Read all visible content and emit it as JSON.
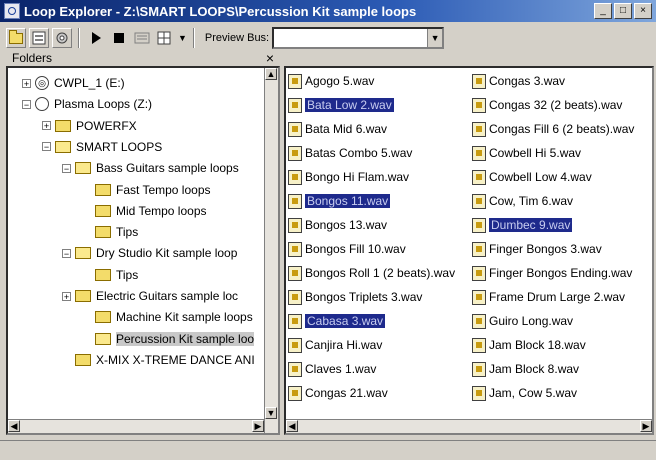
{
  "window": {
    "title": "Loop Explorer - Z:\\SMART LOOPS\\Percussion Kit sample loops",
    "colors": {
      "titlebar": "#0a246a",
      "selection": "#1e2a8c"
    }
  },
  "toolbar": {
    "preview_bus_label": "Preview Bus:",
    "preview_bus_value": ""
  },
  "folders_pane": {
    "header": "Folders",
    "close_glyph": "×",
    "tree": [
      {
        "label": "CWPL_1 (E:)",
        "kind": "cd",
        "expander": "+"
      },
      {
        "label": "Plasma Loops (Z:)",
        "kind": "drive",
        "expander": "−"
      },
      {
        "label": "POWERFX",
        "kind": "folder",
        "expander": "+"
      },
      {
        "label": "SMART LOOPS",
        "kind": "folder-open",
        "expander": "−"
      },
      {
        "label": "Bass Guitars sample loops",
        "kind": "folder-open",
        "expander": "−"
      },
      {
        "label": "Fast Tempo loops",
        "kind": "folder",
        "expander": ""
      },
      {
        "label": "Mid Tempo loops",
        "kind": "folder",
        "expander": ""
      },
      {
        "label": "Tips",
        "kind": "folder",
        "expander": ""
      },
      {
        "label": "Dry Studio Kit sample loop",
        "kind": "folder-open",
        "expander": "−"
      },
      {
        "label": "Tips",
        "kind": "folder",
        "expander": ""
      },
      {
        "label": "Electric Guitars sample loc",
        "kind": "folder",
        "expander": "+"
      },
      {
        "label": "Machine Kit sample loops",
        "kind": "folder",
        "expander": ""
      },
      {
        "label": "Percussion Kit sample loo",
        "kind": "folder-open",
        "expander": "",
        "selected": true
      },
      {
        "label": "X-MIX X-TREME DANCE ANI",
        "kind": "folder",
        "expander": ""
      }
    ]
  },
  "files": {
    "column1": [
      {
        "name": "Agogo 5.wav"
      },
      {
        "name": "Bata Low 2.wav",
        "selected": true
      },
      {
        "name": "Bata Mid 6.wav"
      },
      {
        "name": "Batas Combo 5.wav"
      },
      {
        "name": "Bongo Hi Flam.wav"
      },
      {
        "name": "Bongos 11.wav",
        "selected": true
      },
      {
        "name": "Bongos 13.wav"
      },
      {
        "name": "Bongos Fill 10.wav"
      },
      {
        "name": "Bongos Roll 1 (2 beats).wav"
      },
      {
        "name": "Bongos Triplets 3.wav"
      },
      {
        "name": "Cabasa 3.wav",
        "selected": true
      },
      {
        "name": "Canjira Hi.wav"
      },
      {
        "name": "Claves 1.wav"
      },
      {
        "name": "Congas 21.wav"
      }
    ],
    "column2": [
      {
        "name": "Congas 3.wav"
      },
      {
        "name": "Congas 32 (2 beats).wav"
      },
      {
        "name": "Congas Fill 6 (2 beats).wav"
      },
      {
        "name": "Cowbell Hi 5.wav"
      },
      {
        "name": "Cowbell Low 4.wav"
      },
      {
        "name": "Cow, Tim 6.wav"
      },
      {
        "name": "Dumbec 9.wav",
        "selected": true
      },
      {
        "name": "Finger Bongos 3.wav"
      },
      {
        "name": "Finger Bongos Ending.wav"
      },
      {
        "name": "Frame Drum Large 2.wav"
      },
      {
        "name": "Guiro Long.wav"
      },
      {
        "name": "Jam Block 18.wav"
      },
      {
        "name": "Jam Block 8.wav"
      },
      {
        "name": "Jam, Cow 5.wav"
      }
    ]
  }
}
